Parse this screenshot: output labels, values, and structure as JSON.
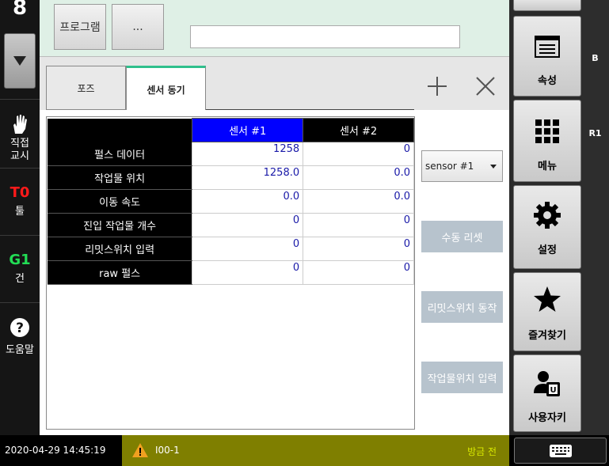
{
  "left_sidebar": {
    "top_number": "8",
    "items": [
      {
        "label_line1": "직접",
        "label_line2": "교시"
      },
      {
        "code": "T0",
        "label": "툴",
        "code_color": "#ff1a1a"
      },
      {
        "code": "G1",
        "label": "건",
        "code_color": "#22dd55"
      },
      {
        "label": "도움말"
      }
    ]
  },
  "top_bar": {
    "program_button": "프로그램",
    "more_button": "...",
    "program_input_value": ""
  },
  "tabs": [
    {
      "label": "포즈"
    },
    {
      "label": "센서 동기"
    }
  ],
  "table": {
    "columns": [
      "센서 #1",
      "센서 #2"
    ],
    "rows": [
      {
        "label": "펄스 데이터",
        "values": [
          "1258",
          "0"
        ]
      },
      {
        "label": "작업물 위치",
        "values": [
          "1258.0",
          "0.0"
        ]
      },
      {
        "label": "이동 속도",
        "values": [
          "0.0",
          "0.0"
        ]
      },
      {
        "label": "진입 작업물 개수",
        "values": [
          "0",
          "0"
        ]
      },
      {
        "label": "리밋스위치 입력",
        "values": [
          "0",
          "0"
        ]
      },
      {
        "label": "raw 펄스",
        "values": [
          "0",
          "0"
        ]
      }
    ]
  },
  "side_controls": {
    "sensor_select_value": "sensor #1",
    "manual_reset_button": "수동 리셋",
    "limit_switch_button": "리밋스위치 동작",
    "workpiece_input_button": "작업물위치 입력"
  },
  "right_panel": {
    "buttons": [
      {
        "label": "속성",
        "icon": "window-icon"
      },
      {
        "label": "메뉴",
        "icon": "grid-icon"
      },
      {
        "label": "설정",
        "icon": "gear-icon"
      },
      {
        "label": "즐겨찾기",
        "icon": "star-icon"
      },
      {
        "label": "사용자키",
        "icon": "user-key-icon"
      }
    ]
  },
  "far_right": {
    "labels": [
      "B",
      "R1"
    ]
  },
  "status_bar": {
    "datetime": "2020-04-29 14:45:19",
    "warning_code": "I00-1",
    "note": "방금 전",
    "colors": {
      "warning_bg": "#7f7f00",
      "note_text": "#d8e800"
    }
  }
}
